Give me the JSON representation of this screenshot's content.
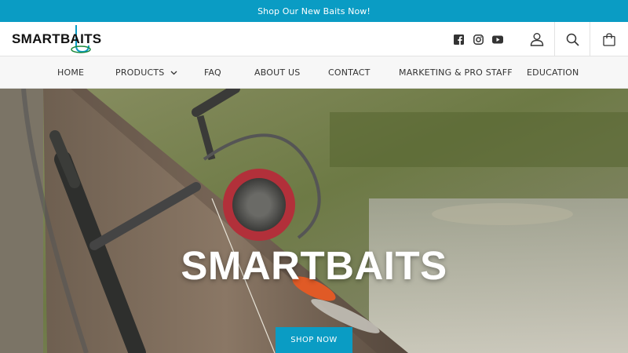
{
  "announcement": {
    "text": "Shop Our New Baits Now!"
  },
  "brand": {
    "logo_text": "SMARTBAITS",
    "accent": "#0a9cc4"
  },
  "social": [
    {
      "icon": "facebook-icon"
    },
    {
      "icon": "instagram-icon"
    },
    {
      "icon": "youtube-icon"
    }
  ],
  "header_actions": {
    "account_icon": "user-icon",
    "search_icon": "search-icon",
    "cart_icon": "bag-icon"
  },
  "nav": {
    "items": [
      {
        "label": "HOME"
      },
      {
        "label": "PRODUCTS",
        "has_dropdown": true
      },
      {
        "label": "FAQ"
      },
      {
        "label": "ABOUT US"
      },
      {
        "label": "CONTACT"
      },
      {
        "label": "MARKETING & PRO STAFF"
      },
      {
        "label": "EDUCATION"
      }
    ]
  },
  "hero": {
    "title": "SMARTBAITS",
    "cta_label": "SHOP NOW"
  }
}
